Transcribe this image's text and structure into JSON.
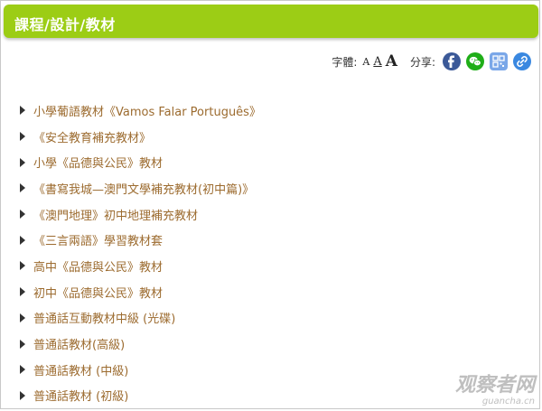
{
  "header": {
    "title": "課程/設計/教材"
  },
  "toolbar": {
    "font_size_label": "字體:",
    "font_small": "A",
    "font_medium": "A",
    "font_large": "A",
    "share_label": "分享:",
    "share_icons": [
      "facebook-icon",
      "wechat-icon",
      "qr-code-icon",
      "link-icon"
    ]
  },
  "materials": [
    "小學葡語教材《Vamos Falar Português》",
    "《安全教育補充教材》",
    "小學《品德與公民》教材",
    "《書寫我城—澳門文學補充教材(初中篇)》",
    "《澳門地理》初中地理補充教材",
    "《三言兩語》學習教材套",
    "高中《品德與公民》教材",
    "初中《品德與公民》教材",
    "普通話互動教材中級 (光碟)",
    "普通話教材(高級)",
    "普通話教材 (中級)",
    "普通話教材 (初級)"
  ],
  "watermark": {
    "main": "观察者网",
    "sub": "guancha.cn"
  },
  "colors": {
    "header": "#9ccd15",
    "link_text": "#9c6b2f"
  }
}
